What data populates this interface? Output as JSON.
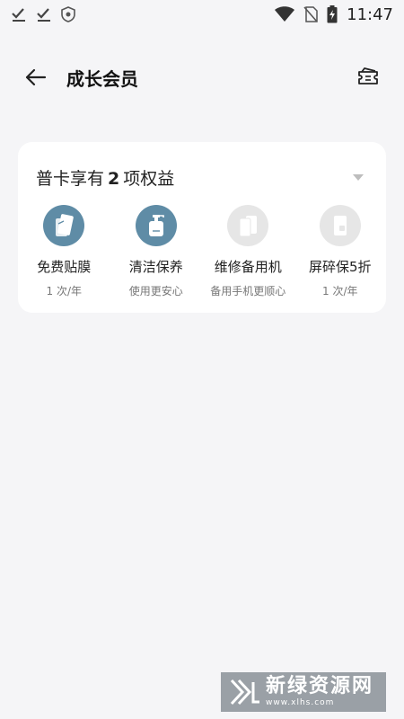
{
  "status_bar": {
    "time": "11:47",
    "left_icons": [
      "check-download-icon",
      "check-download-icon",
      "shield-icon"
    ],
    "right_icons": [
      "wifi-icon",
      "no-sim-icon",
      "battery-charging-icon"
    ]
  },
  "app_bar": {
    "title": "成长会员"
  },
  "card": {
    "header_prefix": "普卡享有",
    "header_count": "2",
    "header_suffix": "项权益",
    "benefits": [
      {
        "name": "免费贴膜",
        "sub": "1 次/年",
        "active": true,
        "icon": "phone-film-icon"
      },
      {
        "name": "清洁保养",
        "sub": "使用更安心",
        "active": true,
        "icon": "cleaning-bottle-icon"
      },
      {
        "name": "维修备用机",
        "sub": "备用手机更顺心",
        "active": false,
        "icon": "backup-phone-icon"
      },
      {
        "name": "屏碎保5折",
        "sub": "1 次/年",
        "active": false,
        "icon": "screen-protect-icon"
      }
    ]
  },
  "watermark": {
    "text": "新绿资源网",
    "url": "www.xlhs.com"
  },
  "colors": {
    "background": "#f5f5f7",
    "card": "#ffffff",
    "active_icon_bg": "#5f8ca6",
    "inactive_icon_bg": "#e6e6e6"
  }
}
